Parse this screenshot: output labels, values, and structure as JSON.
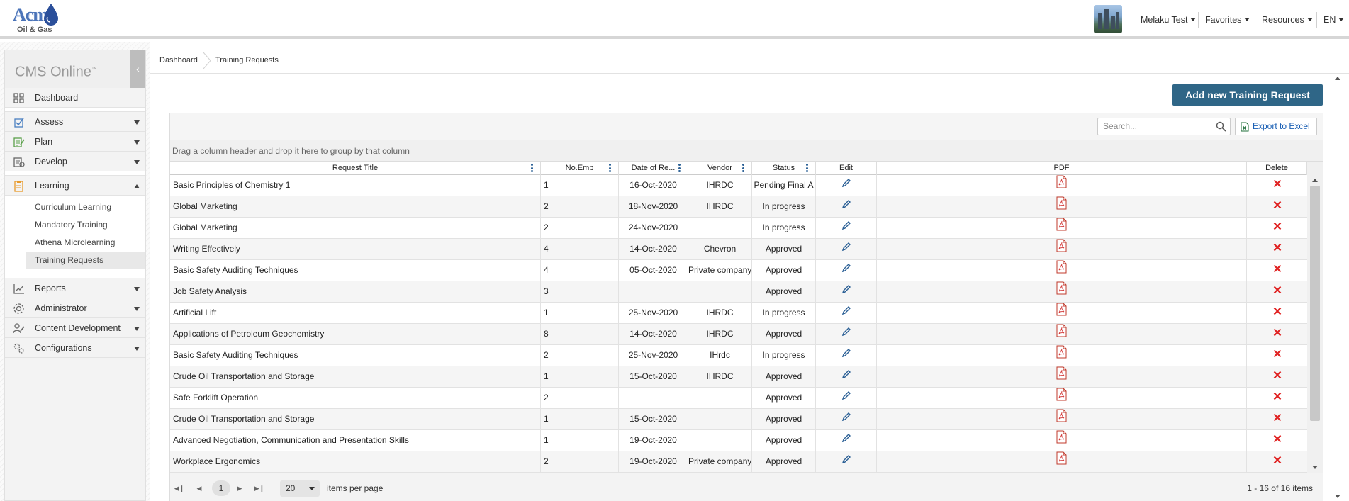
{
  "header": {
    "logo_text": "Acme",
    "logo_sub": "Oil & Gas",
    "user_name": "Melaku Test",
    "favorites": "Favorites",
    "resources": "Resources",
    "language": "EN"
  },
  "sidebar": {
    "app_title": "CMS Online",
    "app_title_mark": "™",
    "collapse_glyph": "‹",
    "items": [
      {
        "label": "Dashboard",
        "icon": "dashboard-icon"
      },
      {
        "label": "Assess",
        "icon": "assess-icon",
        "expanded": false
      },
      {
        "label": "Plan",
        "icon": "plan-icon",
        "expanded": false
      },
      {
        "label": "Develop",
        "icon": "develop-icon",
        "expanded": false
      },
      {
        "label": "Learning",
        "icon": "learning-icon",
        "expanded": true
      },
      {
        "label": "Reports",
        "icon": "reports-icon",
        "expanded": false
      },
      {
        "label": "Administrator",
        "icon": "administrator-icon",
        "expanded": false
      },
      {
        "label": "Content Development",
        "icon": "content-development-icon",
        "expanded": false
      },
      {
        "label": "Configurations",
        "icon": "configurations-icon",
        "expanded": false
      }
    ],
    "learning_subitems": [
      "Curriculum Learning",
      "Mandatory Training",
      "Athena Microlearning",
      "Training Requests"
    ],
    "active_subitem": "Training Requests"
  },
  "breadcrumb": [
    "Dashboard",
    "Training Requests"
  ],
  "main": {
    "add_button": "Add new Training Request",
    "search_placeholder": "Search...",
    "export_label": "Export to Excel",
    "group_hint": "Drag a column header and drop it here to group by that column"
  },
  "table": {
    "columns": [
      "Request Title",
      "No.Emp",
      "Date of Re...",
      "Vendor",
      "Status",
      "Edit",
      "PDF",
      "Delete"
    ],
    "rows": [
      {
        "title": "Basic Principles of Chemistry 1",
        "no": "1",
        "date": "16-Oct-2020",
        "vendor": "IHRDC",
        "status": "Pending Final A"
      },
      {
        "title": "Global Marketing",
        "no": "2",
        "date": "18-Nov-2020",
        "vendor": "IHRDC",
        "status": "In progress"
      },
      {
        "title": "Global Marketing",
        "no": "2",
        "date": "24-Nov-2020",
        "vendor": "",
        "status": "In progress"
      },
      {
        "title": "Writing Effectively",
        "no": "4",
        "date": "14-Oct-2020",
        "vendor": "Chevron",
        "status": "Approved"
      },
      {
        "title": "Basic Safety Auditing Techniques",
        "no": "4",
        "date": "05-Oct-2020",
        "vendor": "Private company",
        "status": "Approved"
      },
      {
        "title": "Job Safety Analysis",
        "no": "3",
        "date": "",
        "vendor": "",
        "status": "Approved"
      },
      {
        "title": "Artificial Lift",
        "no": "1",
        "date": "25-Nov-2020",
        "vendor": "IHRDC",
        "status": "In progress"
      },
      {
        "title": "Applications of Petroleum Geochemistry",
        "no": "8",
        "date": "14-Oct-2020",
        "vendor": "IHRDC",
        "status": "Approved"
      },
      {
        "title": "Basic Safety Auditing Techniques",
        "no": "2",
        "date": "25-Nov-2020",
        "vendor": "IHrdc",
        "status": "In progress"
      },
      {
        "title": "Crude Oil Transportation and Storage",
        "no": "1",
        "date": "15-Oct-2020",
        "vendor": "IHRDC",
        "status": "Approved"
      },
      {
        "title": "Safe Forklift Operation",
        "no": "2",
        "date": "",
        "vendor": "",
        "status": "Approved"
      },
      {
        "title": "Crude Oil Transportation and Storage",
        "no": "1",
        "date": "15-Oct-2020",
        "vendor": "",
        "status": "Approved"
      },
      {
        "title": "Advanced Negotiation, Communication and Presentation Skills",
        "no": "1",
        "date": "19-Oct-2020",
        "vendor": "",
        "status": "Approved"
      },
      {
        "title": "Workplace Ergonomics",
        "no": "2",
        "date": "19-Oct-2020",
        "vendor": "Private company",
        "status": "Approved"
      }
    ]
  },
  "pager": {
    "current_page": "1",
    "page_size": "20",
    "page_size_label": "items per page",
    "info": "1 - 16 of 16 items"
  },
  "colors": {
    "accent": "#2f6687",
    "delete": "#e02020",
    "pdf": "#d33a3a",
    "edit": "#2a5f95"
  }
}
